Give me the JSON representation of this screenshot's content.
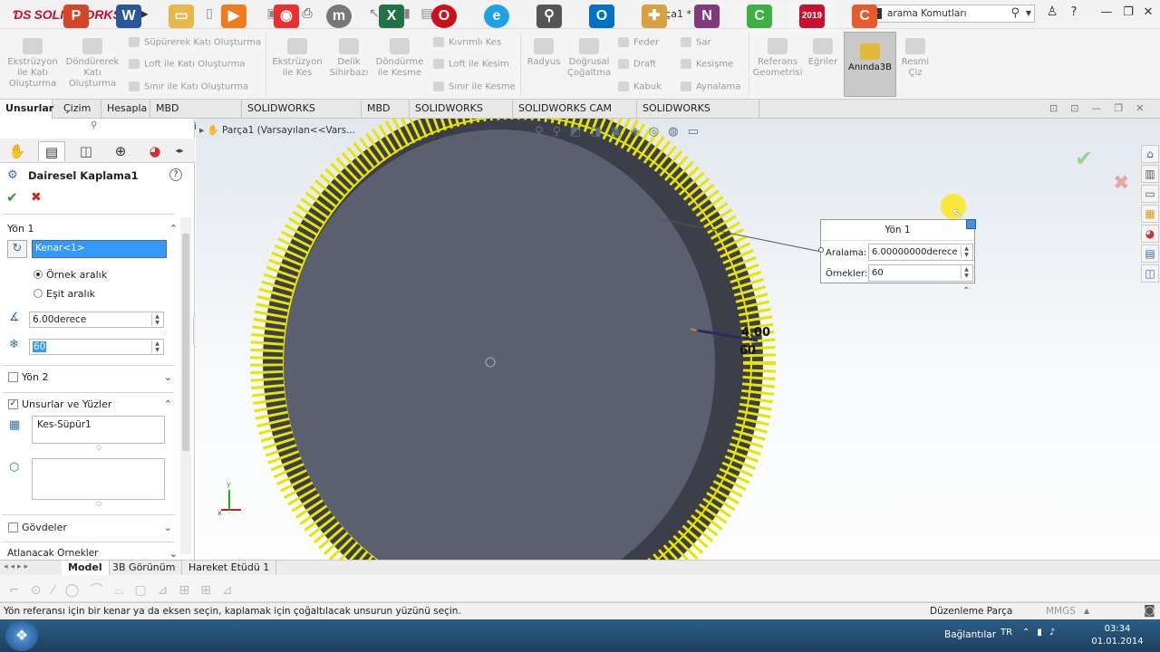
{
  "app": {
    "name": "SOLIDWORKS",
    "document_title": "Parça1 *"
  },
  "search": {
    "placeholder": "arama Komutları"
  },
  "ribbon": {
    "extrude_boss": "Ekstrüzyon ile Katı Oluşturma",
    "revolve_boss": "Döndürerek Katı Oluşturma",
    "sweep_boss": "Süpürerek Katı Oluşturma",
    "loft_boss": "Loft ile Katı Oluşturma",
    "boundary_boss": "Sınır ile Katı Oluşturma",
    "extrude_cut": "Ekstrüzyon ile Kes",
    "hole_wizard": "Delik Sihirbazı",
    "revolve_cut": "Döndürme ile Kesme",
    "sweep_cut": "Kıvrımlı Kes",
    "loft_cut": "Loft ile Kesim",
    "boundary_cut": "Sınır ile Kesme",
    "fillet": "Radyus",
    "linear_pattern": "Doğrusal Çoğaltma",
    "rib": "Feder",
    "draft": "Draft",
    "shell": "Kabuk",
    "wrap": "Sar",
    "intersect": "Kesişme",
    "mirror": "Aynalama",
    "ref_geometry": "Referans Geometrisi",
    "curves": "Eğriler",
    "instant3d": "Anında3B",
    "sketch_pic": "Resmi Çiz"
  },
  "tabs": [
    "Unsurlar",
    "Çizim",
    "Hesapla",
    "MBD Dimensions",
    "SOLIDWORKS Eklentileri",
    "MBD",
    "SOLIDWORKS CAM",
    "SOLIDWORKS CAM TBM",
    "SOLIDWORKS Inspection"
  ],
  "property_manager": {
    "title": "Dairesel Kaplama1",
    "dir1_title": "Yön 1",
    "dir1_edge": "Kenar<1>",
    "instance_spacing": "Örnek aralık",
    "equal_spacing": "Eşit aralık",
    "angle_value": "6.00derece",
    "instances_value": "60",
    "dir2_title": "Yön 2",
    "features_title": "Unsurlar ve Yüzler",
    "feature_item": "Kes-Süpür1",
    "bodies_title": "Gövdeler",
    "skip_title": "Atlanacak Örnekler"
  },
  "feature_tree": {
    "root": "Parça1  (Varsayılan<<Vars..."
  },
  "callout": {
    "title": "Yön 1",
    "spacing_label": "Aralama:",
    "spacing_value": "6.00000000derece",
    "instances_label": "Örnekler:",
    "instances_value": "60"
  },
  "dimension": {
    "value1": "4.00",
    "value2": "60"
  },
  "bottom_tabs": [
    "Model",
    "3B Görünüm",
    "Hareket Etüdü 1"
  ],
  "status": {
    "message": "Yön referansı için bir kenar ya da eksen seçin, kaplamak için çoğaltılacak unsurun yüzünü seçin.",
    "mode": "Düzenleme Parça",
    "units": "MMGS"
  },
  "taskbar": {
    "connections": "Bağlantılar",
    "lang": "TR",
    "time": "03:34",
    "date": "01.01.2014",
    "sw_version": "2019"
  },
  "colors": {
    "gear_yellow": "#e8e600",
    "gear_face": "#5b6070",
    "accent": "#c8102e"
  }
}
